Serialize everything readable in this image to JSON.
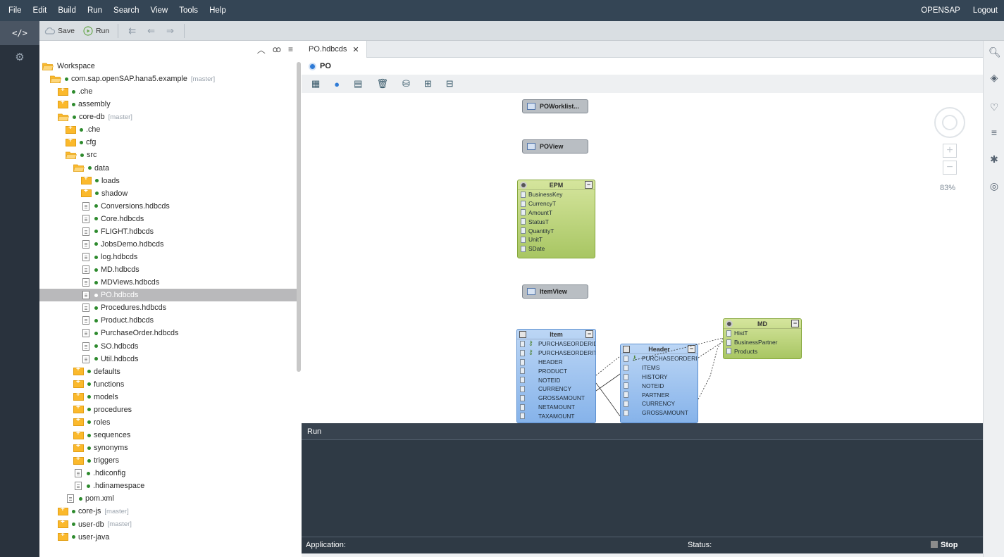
{
  "menubar": {
    "items": [
      "File",
      "Edit",
      "Build",
      "Run",
      "Search",
      "View",
      "Tools",
      "Help"
    ],
    "user": "OPENSAP",
    "logout": "Logout"
  },
  "toolbar": {
    "save_label": "Save",
    "run_label": "Run"
  },
  "tree": {
    "nodes": [
      {
        "label": "Workspace",
        "branch": "",
        "icon": "folder-open",
        "indent": 0,
        "dot": false
      },
      {
        "label": "com.sap.openSAP.hana5.example",
        "branch": "[master]",
        "icon": "folder-open",
        "indent": 1,
        "dot": true
      },
      {
        "label": ".che",
        "branch": "",
        "icon": "folder",
        "indent": 2,
        "dot": true
      },
      {
        "label": "assembly",
        "branch": "",
        "icon": "folder",
        "indent": 2,
        "dot": true
      },
      {
        "label": "core-db",
        "branch": "[master]",
        "icon": "folder-open",
        "indent": 2,
        "dot": true
      },
      {
        "label": ".che",
        "branch": "",
        "icon": "folder",
        "indent": 3,
        "dot": true
      },
      {
        "label": "cfg",
        "branch": "",
        "icon": "folder",
        "indent": 3,
        "dot": true
      },
      {
        "label": "src",
        "branch": "",
        "icon": "folder-open",
        "indent": 3,
        "dot": true
      },
      {
        "label": "data",
        "branch": "",
        "icon": "folder-open",
        "indent": 4,
        "dot": true
      },
      {
        "label": "loads",
        "branch": "",
        "icon": "folder",
        "indent": 5,
        "dot": true
      },
      {
        "label": "shadow",
        "branch": "",
        "icon": "folder",
        "indent": 5,
        "dot": true
      },
      {
        "label": "Conversions.hdbcds",
        "branch": "",
        "icon": "file",
        "indent": 5,
        "dot": true
      },
      {
        "label": "Core.hdbcds",
        "branch": "",
        "icon": "file",
        "indent": 5,
        "dot": true
      },
      {
        "label": "FLIGHT.hdbcds",
        "branch": "",
        "icon": "file",
        "indent": 5,
        "dot": true
      },
      {
        "label": "JobsDemo.hdbcds",
        "branch": "",
        "icon": "file",
        "indent": 5,
        "dot": true
      },
      {
        "label": "log.hdbcds",
        "branch": "",
        "icon": "file",
        "indent": 5,
        "dot": true
      },
      {
        "label": "MD.hdbcds",
        "branch": "",
        "icon": "file",
        "indent": 5,
        "dot": true
      },
      {
        "label": "MDViews.hdbcds",
        "branch": "",
        "icon": "file",
        "indent": 5,
        "dot": true
      },
      {
        "label": "PO.hdbcds",
        "branch": "",
        "icon": "file",
        "indent": 5,
        "dot": true,
        "selected": true
      },
      {
        "label": "Procedures.hdbcds",
        "branch": "",
        "icon": "file",
        "indent": 5,
        "dot": true
      },
      {
        "label": "Product.hdbcds",
        "branch": "",
        "icon": "file",
        "indent": 5,
        "dot": true
      },
      {
        "label": "PurchaseOrder.hdbcds",
        "branch": "",
        "icon": "file",
        "indent": 5,
        "dot": true
      },
      {
        "label": "SO.hdbcds",
        "branch": "",
        "icon": "file",
        "indent": 5,
        "dot": true
      },
      {
        "label": "Util.hdbcds",
        "branch": "",
        "icon": "file",
        "indent": 5,
        "dot": true
      },
      {
        "label": "defaults",
        "branch": "",
        "icon": "folder",
        "indent": 4,
        "dot": true
      },
      {
        "label": "functions",
        "branch": "",
        "icon": "folder",
        "indent": 4,
        "dot": true
      },
      {
        "label": "models",
        "branch": "",
        "icon": "folder",
        "indent": 4,
        "dot": true
      },
      {
        "label": "procedures",
        "branch": "",
        "icon": "folder",
        "indent": 4,
        "dot": true
      },
      {
        "label": "roles",
        "branch": "",
        "icon": "folder",
        "indent": 4,
        "dot": true
      },
      {
        "label": "sequences",
        "branch": "",
        "icon": "folder",
        "indent": 4,
        "dot": true
      },
      {
        "label": "synonyms",
        "branch": "",
        "icon": "folder",
        "indent": 4,
        "dot": true
      },
      {
        "label": "triggers",
        "branch": "",
        "icon": "folder",
        "indent": 4,
        "dot": true
      },
      {
        "label": ".hdiconfig",
        "branch": "",
        "icon": "file",
        "indent": 4,
        "dot": true
      },
      {
        "label": ".hdinamespace",
        "branch": "",
        "icon": "file",
        "indent": 4,
        "dot": true
      },
      {
        "label": "pom.xml",
        "branch": "",
        "icon": "file",
        "indent": 3,
        "dot": true
      },
      {
        "label": "core-js",
        "branch": "[master]",
        "icon": "folder",
        "indent": 2,
        "dot": true
      },
      {
        "label": "user-db",
        "branch": "[master]",
        "icon": "folder",
        "indent": 2,
        "dot": true
      },
      {
        "label": "user-java",
        "branch": "",
        "icon": "folder",
        "indent": 2,
        "dot": true
      }
    ]
  },
  "editor": {
    "tab_label": "PO.hdbcds",
    "breadcrumb": "PO",
    "canvas": {
      "views": [
        "POWorklist...",
        "POView",
        "ItemView"
      ],
      "epm": {
        "title": "EPM",
        "fields": [
          "BusinessKey",
          "CurrencyT",
          "AmountT",
          "StatusT",
          "QuantityT",
          "UnitT",
          "SDate"
        ]
      },
      "md": {
        "title": "MD",
        "fields": [
          "HistT",
          "BusinessPartner",
          "Products"
        ]
      },
      "item": {
        "title": "Item",
        "fields": [
          "PURCHASEORDERID",
          "PURCHASEORDERITEM",
          "HEADER",
          "PRODUCT",
          "NOTEID",
          "CURRENCY",
          "GROSSAMOUNT",
          "NETAMOUNT",
          "TAXAMOUNT"
        ]
      },
      "header": {
        "title": "Header",
        "fields": [
          "PURCHASEORDERID",
          "ITEMS",
          "HISTORY",
          "NOTEID",
          "PARTNER",
          "CURRENCY",
          "GROSSAMOUNT"
        ]
      },
      "zoom": "83%"
    }
  },
  "run_panel": {
    "title": "Run"
  },
  "status_bar": {
    "application_label": "Application:",
    "status_label": "Status:",
    "stop_label": "Stop"
  }
}
